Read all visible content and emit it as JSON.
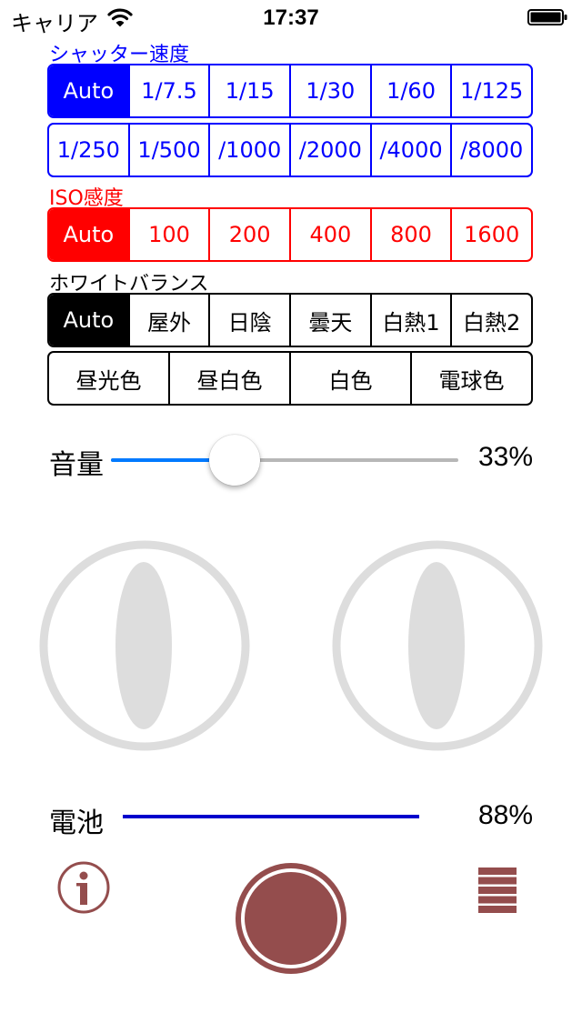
{
  "status_bar": {
    "carrier": "キャリア",
    "time": "17:37"
  },
  "shutter": {
    "label": "シャッター速度",
    "row1": [
      "Auto",
      "1/7.5",
      "1/15",
      "1/30",
      "1/60",
      "1/125"
    ],
    "row2": [
      "1/250",
      "1/500",
      "/1000",
      "/2000",
      "/4000",
      "/8000"
    ],
    "selected": "Auto",
    "color": "#0000ff"
  },
  "iso": {
    "label": "ISO感度",
    "options": [
      "Auto",
      "100",
      "200",
      "400",
      "800",
      "1600"
    ],
    "selected": "Auto",
    "color": "#ff0000"
  },
  "white_balance": {
    "label": "ホワイトバランス",
    "row1": [
      "Auto",
      "屋外",
      "日陰",
      "曇天",
      "白熱1",
      "白熱2"
    ],
    "row2": [
      "昼光色",
      "昼白色",
      "白色",
      "電球色"
    ],
    "selected": "Auto"
  },
  "volume": {
    "label": "音量",
    "value_text": "33%",
    "level": 0.33,
    "accent": "#007aff"
  },
  "joysticks": {
    "left": "joystick",
    "right": "joystick"
  },
  "battery": {
    "label": "電池",
    "value_text": "88%",
    "accent": "#0000cc"
  },
  "bottom_bar": {
    "info_icon": "info-icon",
    "record_icon": "record-button",
    "menu_icon": "menu-icon",
    "color": "#944d4d"
  }
}
